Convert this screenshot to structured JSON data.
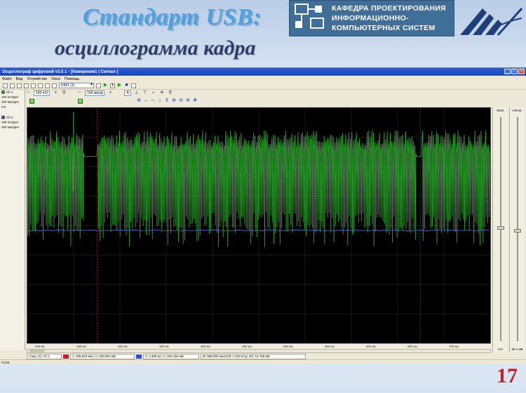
{
  "slide": {
    "title_line1": "Стандарт USB:",
    "title_line2": "осциллограмма кадра",
    "department": [
      "КАФЕДРА ПРОЕКТИРОВАНИЯ",
      "ИНФОРМАЦИОННО-",
      "КОМПЬЮТЕРНЫХ СИСТЕМ"
    ],
    "page_number": "17"
  },
  "window": {
    "title": "Осциллограф цифровой v3.0.1 - [Измерение1 | Сигнал ]",
    "menu": [
      "Файл",
      "Вид",
      "Устройство",
      "Окно",
      "Помощь"
    ],
    "device_select": "D421 (1)",
    "channel_ctrl": {
      "voltage": "100 mV",
      "time": "100 мкс/д",
      "mode": "A"
    },
    "channels": [
      {
        "name": "Ch 1",
        "scale": "100 mV/дел",
        "time": "100 мкс/дел",
        "swatch": "#2e9a2e"
      },
      {
        "name": "Ch 2",
        "scale": "100 mV/дел",
        "time": "100 мкс/дел",
        "swatch": "#2a4fc0"
      }
    ],
    "xaxis_ticks": [
      "200 мс",
      "250 мс",
      "300 мс",
      "350 мс",
      "400 мс",
      "450 мс",
      "500 мс",
      "550 мс",
      "600 мс",
      "650 мс",
      "700 мс"
    ],
    "side_left": {
      "title": "Уров.",
      "value": "0.0"
    },
    "side_right": {
      "title": "Синхр.",
      "value": "90.1 мВ"
    },
    "measurements": [
      "след. (1): Ch 1",
      "1: 180.634 мкс; U: 220.981 мВ",
      "2: 1.309 мс; U: 204.194 мВ",
      "dt: 980.000 мкс(1/dt: 1.020 кГц); dU: 16.759 мВ"
    ],
    "status": "Готов"
  },
  "colors": {
    "trace_ch1": "#3fbf3f",
    "trace_ch2": "#3a6bd8",
    "marker_red": "#c0202a",
    "marker_blue": "#3050e0"
  }
}
